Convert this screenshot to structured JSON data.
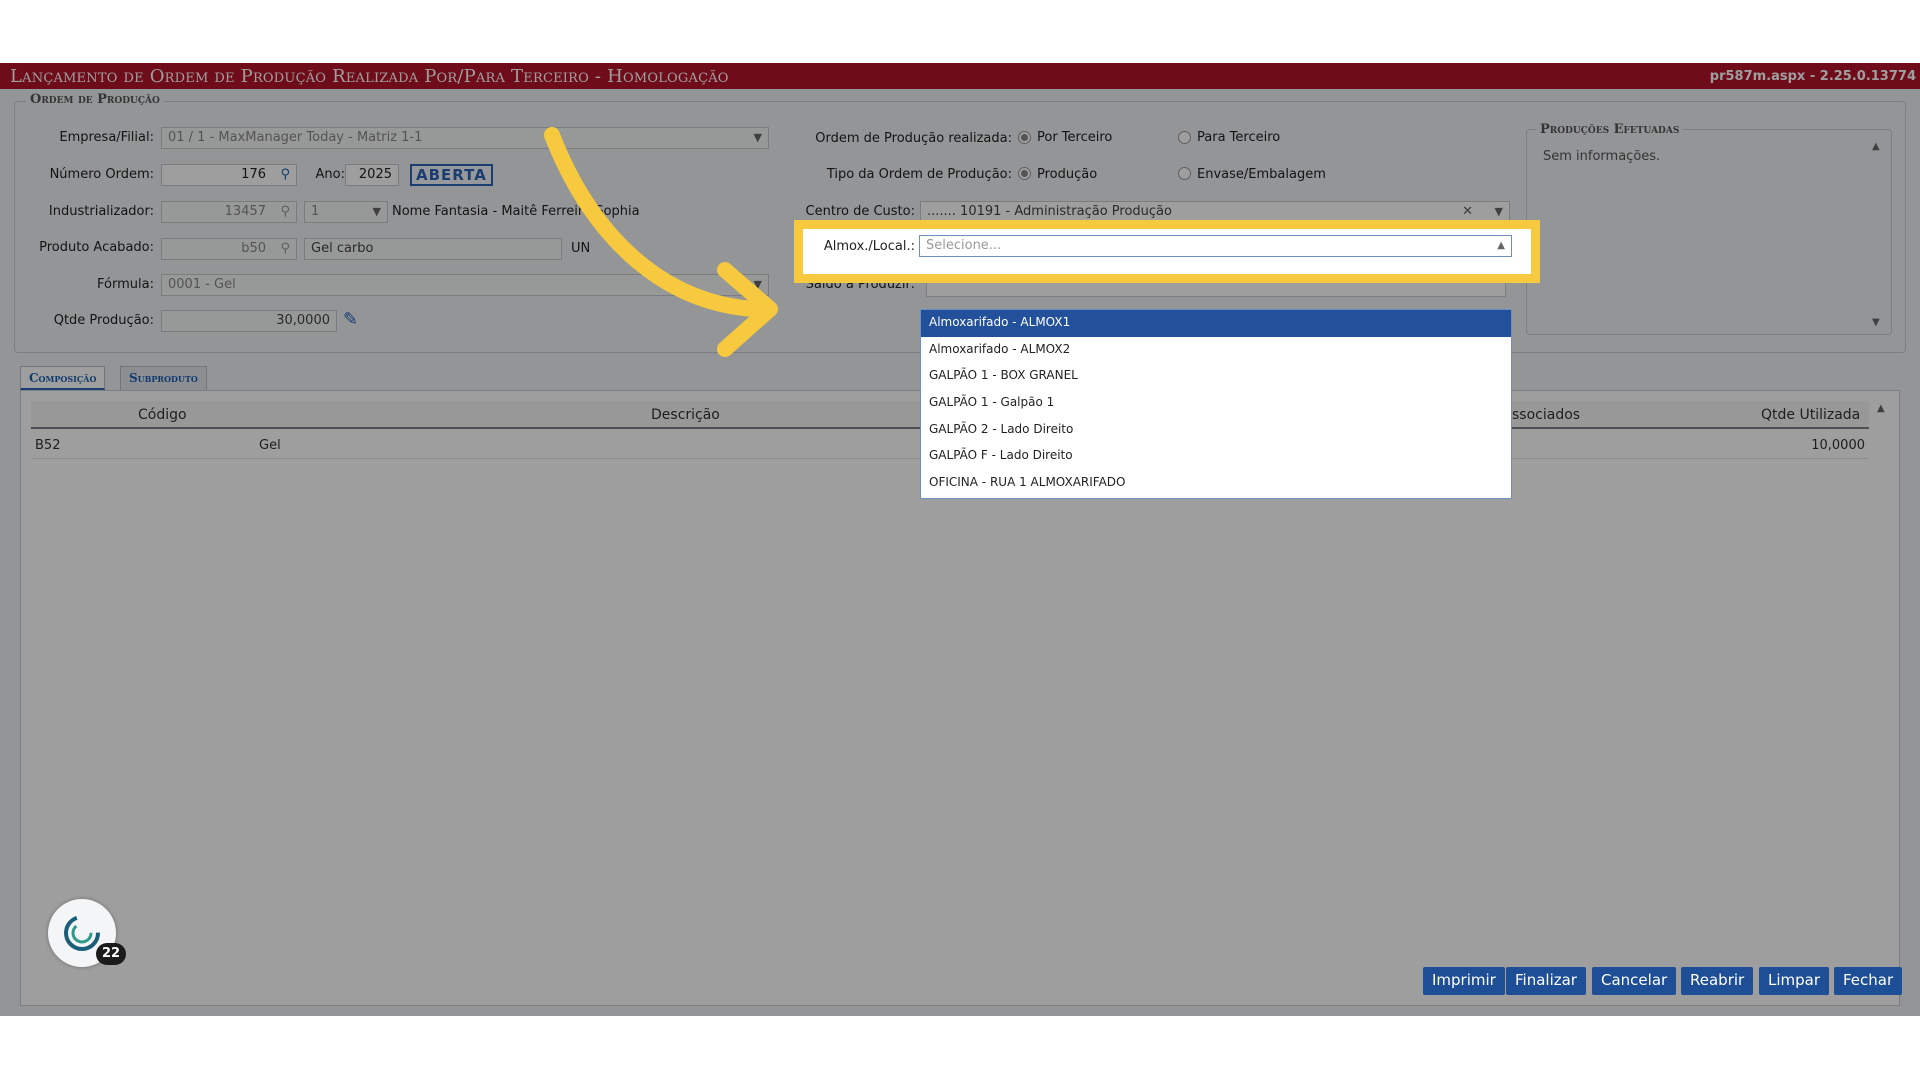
{
  "window": {
    "title": "Lançamento de Ordem de Produção Realizada Por/Para Terceiro  - Homologação",
    "version": "pr587m.aspx - 2.25.0.13774"
  },
  "ordem": {
    "legend": "Ordem de Produção",
    "empresa_label": "Empresa/Filial:",
    "empresa_value": "01 / 1 - MaxManager Today - Matriz 1-1",
    "numero_label": "Número Ordem:",
    "numero_value": "176",
    "ano_label": "Ano:",
    "ano_value": "2025",
    "status": "ABERTA",
    "industrializador_label": "Industrializador:",
    "industrializador_code": "13457",
    "industrializador_seq": "1",
    "industrializador_name": "Nome Fantasia - Maitê Ferreira Sophia",
    "produto_label": "Produto Acabado:",
    "produto_code": "b50",
    "produto_desc": "Gel carbo",
    "produto_un": "UN",
    "formula_label": "Fórmula:",
    "formula_value": "0001 - Gel",
    "qtde_label": "Qtde Produção:",
    "qtde_value": "30,0000",
    "realizada_label": "Ordem de Produção realizada:",
    "por_terceiro": "Por Terceiro",
    "para_terceiro": "Para Terceiro",
    "tipo_label": "Tipo da Ordem de Produção:",
    "producao": "Produção",
    "envase": "Envase/Embalagem",
    "centro_label": "Centro de Custo:",
    "centro_value": "....... 10191 - Administração Produção",
    "almox_label": "Almox./Local.:",
    "almox_placeholder": "Selecione...",
    "saldo_label": "Saldo a Produzir:"
  },
  "producoes": {
    "legend": "Produções Efetuadas",
    "empty": "Sem informações."
  },
  "tabs": [
    "Composição",
    "Subproduto"
  ],
  "grid": {
    "columns": [
      "Código",
      "Descrição",
      "ssociados",
      "Qtde Utilizada"
    ],
    "rows": [
      {
        "codigo": "B52",
        "descricao": "Gel",
        "qtde": "10,0000"
      }
    ]
  },
  "dropdown_options": [
    "Almoxarifado - ALMOX1",
    "Almoxarifado - ALMOX2",
    "GALPÃO 1 - BOX GRANEL",
    "GALPÃO 1 - Galpão 1",
    "GALPÃO 2 - Lado Direito",
    "GALPÃO F - Lado Direito",
    "OFICINA - RUA 1 ALMOXARIFADO"
  ],
  "buttons": [
    "Imprimir",
    "Finalizar",
    "Cancelar",
    "Reabrir",
    "Limpar",
    "Fechar"
  ],
  "notification_count": "22",
  "colors": {
    "titlebar": "#b3142a",
    "highlight": "#f6c93e",
    "button": "#1d4e96",
    "selected": "#23509a"
  }
}
